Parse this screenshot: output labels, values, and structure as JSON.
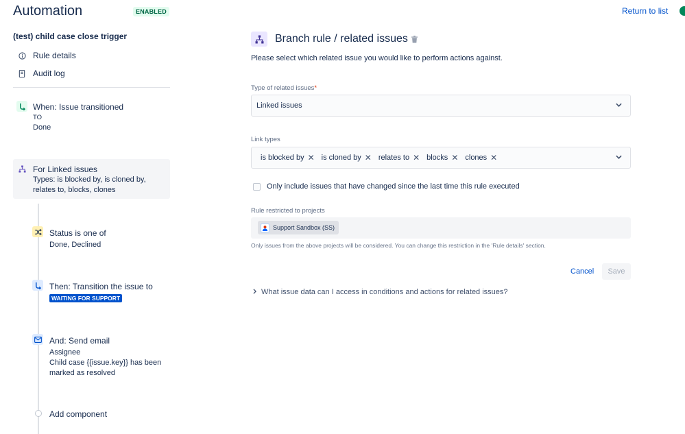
{
  "header": {
    "title": "Automation",
    "badge": "ENABLED",
    "return_link": "Return to list"
  },
  "sidebar": {
    "rule_name": "(test) child case close trigger",
    "nav": [
      {
        "label": "Rule details",
        "icon": "info-icon"
      },
      {
        "label": "Audit log",
        "icon": "document-icon"
      }
    ],
    "steps": {
      "trigger": {
        "title": "When: Issue transitioned",
        "line1": "TO",
        "line2": "Done",
        "icon": "transition-icon"
      },
      "branch": {
        "title": "For Linked issues",
        "line1": "Types: is blocked by, is cloned by,",
        "line2": "relates to, blocks, clones",
        "icon": "branch-icon"
      },
      "condition": {
        "title": "Status is one of",
        "line1": "Done, Declined",
        "icon": "shuffle-icon"
      },
      "action": {
        "title": "Then: Transition the issue to",
        "status": "WAITING FOR SUPPORT",
        "icon": "transition-icon"
      },
      "email": {
        "title": "And: Send email",
        "line1": "Assignee",
        "line2": "Child case {{issue.key}} has been",
        "line3": "marked as resolved",
        "icon": "mail-icon"
      },
      "add": {
        "label": "Add component"
      }
    }
  },
  "panel": {
    "title": "Branch rule / related issues",
    "description": "Please select which related issue you would like to perform actions against.",
    "related_type": {
      "label": "Type of related issues",
      "required_mark": "*",
      "value": "Linked issues"
    },
    "link_types": {
      "label": "Link types",
      "chips": [
        "is blocked by",
        "is cloned by",
        "relates to",
        "blocks",
        "clones"
      ]
    },
    "checkbox_label": "Only include issues that have changed since the last time this rule executed",
    "projects": {
      "label": "Rule restricted to projects",
      "chip": "Support Sandbox (SS)",
      "help": "Only issues from the above projects will be considered. You can change this restriction in the 'Rule details' section."
    },
    "cancel_label": "Cancel",
    "save_label": "Save",
    "faq": "What issue data can I access in conditions and actions for related issues?"
  },
  "colors": {
    "accent": "#0052cc",
    "enabled_bg": "#e3fcef",
    "enabled_text": "#006644",
    "branch_bg": "#eae6ff"
  }
}
